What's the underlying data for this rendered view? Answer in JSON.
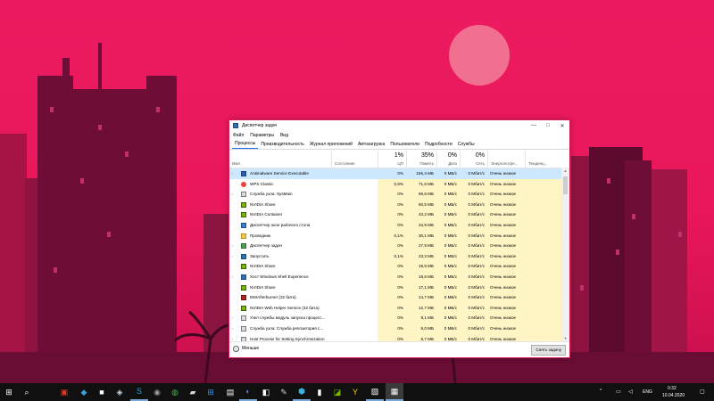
{
  "colors": {
    "accent": "#e8175a",
    "cpu_column_fill": "#fff4c4",
    "selection": "#cce8ff",
    "taskbar": "#101010"
  },
  "window": {
    "title": "Диспетчер задач",
    "controls": {
      "minimize": "—",
      "maximize": "□",
      "close": "✕"
    }
  },
  "menu": [
    "Файл",
    "Параметры",
    "Вид"
  ],
  "tabs": [
    {
      "label": "Процессы",
      "active": true
    },
    {
      "label": "Производительность",
      "active": false
    },
    {
      "label": "Журнал приложений",
      "active": false
    },
    {
      "label": "Автозагрузка",
      "active": false
    },
    {
      "label": "Пользователи",
      "active": false
    },
    {
      "label": "Подробности",
      "active": false
    },
    {
      "label": "Службы",
      "active": false
    }
  ],
  "columns": {
    "name": "Имя",
    "status": "Состояние",
    "cpu": {
      "percent": "1%",
      "label": "ЦП"
    },
    "memory": {
      "percent": "35%",
      "label": "Память"
    },
    "disk": {
      "percent": "0%",
      "label": "Диск"
    },
    "network": {
      "percent": "0%",
      "label": "Сеть"
    },
    "power": "Энергопотре...",
    "trend": "Тенденц..."
  },
  "processes": [
    {
      "name": "Antimalware Service Executable",
      "expandable": true,
      "icon": "shield-process-icon",
      "cpu": "0%",
      "memory": "155,4 МБ",
      "disk": "0 МБ/с",
      "network": "0 Мбит/с",
      "power": "Очень низкое",
      "selected": true
    },
    {
      "name": "WPS Classic",
      "expandable": false,
      "icon": "wps-icon",
      "cpu": "0,6%",
      "memory": "71,6 МБ",
      "disk": "0 МБ/с",
      "network": "0 Мбит/с",
      "power": "Очень низкое",
      "selected": false
    },
    {
      "name": "Служба узла: SysMain",
      "expandable": true,
      "icon": "service-host-icon",
      "cpu": "0%",
      "memory": "66,6 МБ",
      "disk": "0 МБ/с",
      "network": "0 Мбит/с",
      "power": "Очень низкое",
      "selected": false
    },
    {
      "name": "NVIDIA Share",
      "expandable": false,
      "icon": "nvidia-icon",
      "cpu": "0%",
      "memory": "60,5 МБ",
      "disk": "0 МБ/с",
      "network": "0 Мбит/с",
      "power": "Очень низкое",
      "selected": false
    },
    {
      "name": "NVIDIA Container",
      "expandable": false,
      "icon": "nvidia-icon",
      "cpu": "0%",
      "memory": "43,2 МБ",
      "disk": "0 МБ/с",
      "network": "0 Мбит/с",
      "power": "Очень низкое",
      "selected": false
    },
    {
      "name": "Диспетчер окон рабочего стола",
      "expandable": false,
      "icon": "desktop-window-manager-icon",
      "cpu": "0%",
      "memory": "34,9 МБ",
      "disk": "0 МБ/с",
      "network": "0 Мбит/с",
      "power": "Очень низкое",
      "selected": false
    },
    {
      "name": "Проводник",
      "expandable": false,
      "icon": "explorer-folder-icon",
      "cpu": "0,1%",
      "memory": "30,1 МБ",
      "disk": "0 МБ/с",
      "network": "0 Мбит/с",
      "power": "Очень низкое",
      "selected": false
    },
    {
      "name": "Диспетчер задач",
      "expandable": true,
      "icon": "task-manager-icon",
      "cpu": "0%",
      "memory": "27,9 МБ",
      "disk": "0 МБ/с",
      "network": "0 Мбит/с",
      "power": "Очень низкое",
      "selected": false
    },
    {
      "name": "Запустить",
      "expandable": true,
      "icon": "generic-window-icon",
      "cpu": "0,1%",
      "memory": "23,3 МБ",
      "disk": "0 МБ/с",
      "network": "0 Мбит/с",
      "power": "Очень низкое",
      "selected": false
    },
    {
      "name": "NVIDIA Share",
      "expandable": false,
      "icon": "nvidia-icon",
      "cpu": "0%",
      "memory": "19,9 МБ",
      "disk": "0 МБ/с",
      "network": "0 Мбит/с",
      "power": "Очень низкое",
      "selected": false
    },
    {
      "name": "Хост Windows Shell Experience",
      "expandable": true,
      "icon": "generic-window-icon",
      "cpu": "0%",
      "memory": "18,6 МБ",
      "disk": "0 МБ/с",
      "network": "0 Мбит/с",
      "power": "Очень низкое",
      "selected": false
    },
    {
      "name": "NVIDIA Share",
      "expandable": false,
      "icon": "nvidia-icon",
      "cpu": "0%",
      "memory": "17,1 МБ",
      "disk": "0 МБ/с",
      "network": "0 Мбит/с",
      "power": "Очень низкое",
      "selected": false
    },
    {
      "name": "MSIAfterburner (32 бита)",
      "expandable": false,
      "icon": "afterburner-icon",
      "cpu": "0%",
      "memory": "14,7 МБ",
      "disk": "0 МБ/с",
      "network": "0 Мбит/с",
      "power": "Очень низкое",
      "selected": false
    },
    {
      "name": "NVIDIA Web Helper Service (32 бита)",
      "expandable": false,
      "icon": "nvidia-icon",
      "cpu": "0%",
      "memory": "12,7 МБ",
      "disk": "0 МБ/с",
      "network": "0 Мбит/с",
      "power": "Очень низкое",
      "selected": false
    },
    {
      "name": "Узел службы модуль запуска процесс...",
      "expandable": true,
      "icon": "service-host-icon",
      "cpu": "0%",
      "memory": "9,1 МБ",
      "disk": "0 МБ/с",
      "network": "0 Мбит/с",
      "power": "Очень низкое",
      "selected": false
    },
    {
      "name": "Служба узла: Служба репозитория с...",
      "expandable": true,
      "icon": "service-host-icon",
      "cpu": "0%",
      "memory": "9,0 МБ",
      "disk": "0 МБ/с",
      "network": "0 Мбит/с",
      "power": "Очень низкое",
      "selected": false
    },
    {
      "name": "Host Process for Setting Synchronization",
      "expandable": true,
      "icon": "service-host-icon",
      "cpu": "0%",
      "memory": "8,7 МБ",
      "disk": "0 МБ/с",
      "network": "0 Мбит/с",
      "power": "Очень низкое",
      "selected": false
    }
  ],
  "footer": {
    "fewer_label": "Меньше",
    "end_task_label": "Снять задачу"
  },
  "taskbar": {
    "items": [
      {
        "name": "start-button",
        "glyph": "⊞",
        "color": "#ffffff",
        "state": "normal"
      },
      {
        "name": "search-button",
        "glyph": "⌕",
        "color": "#ffffff",
        "state": "normal"
      },
      {
        "name": "taskbar-app-office",
        "glyph": "▣",
        "color": "#e03a2a",
        "state": "normal"
      },
      {
        "name": "taskbar-app-store",
        "glyph": "◆",
        "color": "#3aa0e0",
        "state": "normal"
      },
      {
        "name": "taskbar-app-briefcase",
        "glyph": "■",
        "color": "#ffffff",
        "state": "normal"
      },
      {
        "name": "taskbar-app-steam",
        "glyph": "◈",
        "color": "#c7d5e0",
        "state": "normal"
      },
      {
        "name": "taskbar-app-skype",
        "glyph": "S",
        "color": "#2aa3e0",
        "state": "running"
      },
      {
        "name": "taskbar-app-media",
        "glyph": "◉",
        "color": "#9a9a9a",
        "state": "normal"
      },
      {
        "name": "taskbar-app-chrome",
        "glyph": "◍",
        "color": "#4caf50",
        "state": "normal"
      },
      {
        "name": "taskbar-app-game",
        "glyph": "▰",
        "color": "#d8d8d8",
        "state": "normal"
      },
      {
        "name": "taskbar-app-windows",
        "glyph": "⊞",
        "color": "#3a8ee6",
        "state": "normal"
      },
      {
        "name": "taskbar-app-editor",
        "glyph": "▤",
        "color": "#ffffff",
        "state": "normal"
      },
      {
        "name": "taskbar-app-blue",
        "glyph": "◐",
        "color": "#4a7fe0",
        "state": "running"
      },
      {
        "name": "taskbar-app-screenshot",
        "glyph": "◧",
        "color": "#ffffff",
        "state": "normal"
      },
      {
        "name": "taskbar-app-tools",
        "glyph": "✎",
        "color": "#cfcfcf",
        "state": "normal"
      },
      {
        "name": "taskbar-app-network",
        "glyph": "⬢",
        "color": "#3ab0e6",
        "state": "running"
      },
      {
        "name": "taskbar-app-terminal",
        "glyph": "▮",
        "color": "#ffffff",
        "state": "normal"
      },
      {
        "name": "taskbar-app-nvidia",
        "glyph": "◪",
        "color": "#76b900",
        "state": "normal"
      },
      {
        "name": "taskbar-app-yandex",
        "glyph": "Y",
        "color": "#ffd000",
        "state": "normal"
      },
      {
        "name": "taskbar-app-pdf",
        "glyph": "▨",
        "color": "#ffffff",
        "state": "running"
      },
      {
        "name": "taskbar-app-task-manager",
        "glyph": "▦",
        "color": "#ffffff",
        "state": "active"
      }
    ],
    "tray": {
      "chevron": "^",
      "language": "ENG",
      "time": "0:32",
      "date": "10.04.2020",
      "notifications_glyph": "▢"
    }
  }
}
